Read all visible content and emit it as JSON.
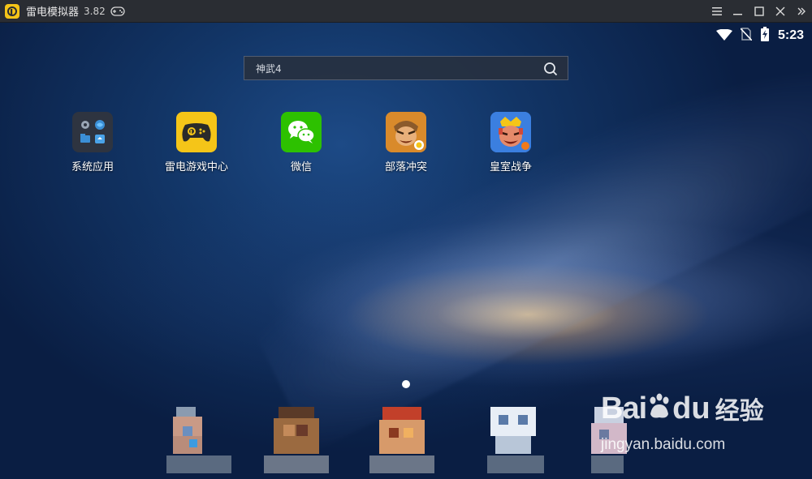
{
  "window": {
    "title": "雷电模拟器",
    "version": "3.82",
    "controls": [
      "menu-icon",
      "minimize-icon",
      "maximize-icon",
      "close-icon",
      "expand-sidebar-icon"
    ]
  },
  "statusbar": {
    "time": "5:23",
    "icons": [
      "wifi-icon",
      "no-sim-icon",
      "battery-charging-icon"
    ]
  },
  "search": {
    "text": "神武4",
    "icon": "search-icon"
  },
  "apps": [
    {
      "label": "系统应用",
      "icon": "system-apps-folder-icon"
    },
    {
      "label": "雷电游戏中心",
      "icon": "leidian-game-center-icon",
      "color": "#f5c518"
    },
    {
      "label": "微信",
      "icon": "wechat-icon",
      "color": "#2dc100"
    },
    {
      "label": "部落冲突",
      "icon": "clash-of-clans-icon"
    },
    {
      "label": "皇室战争",
      "icon": "clash-royale-icon"
    }
  ],
  "pager": {
    "pages": 1,
    "current": 1
  },
  "dock": {
    "items": [
      "dock-app-1 (pixelated)",
      "dock-app-2 (pixelated)",
      "dock-app-3 (pixelated)",
      "dock-app-4 (pixelated)",
      "dock-app-5 (pixelated)"
    ]
  },
  "watermark": {
    "brand_left": "Bai",
    "brand_right": "du",
    "brand_cn": "经验",
    "url": "jingyan.baidu.com"
  }
}
